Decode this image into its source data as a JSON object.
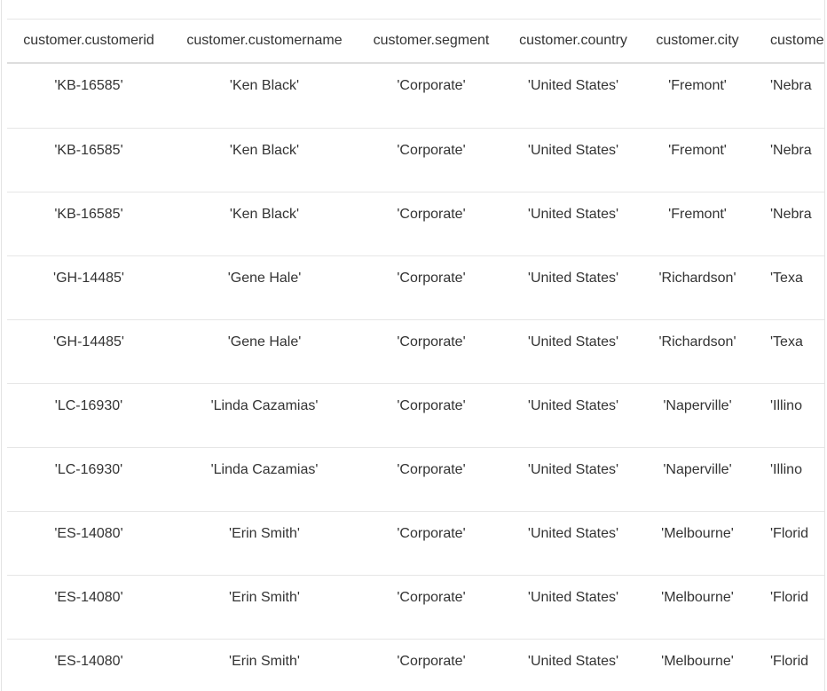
{
  "table": {
    "columns": [
      "customer.customerid",
      "customer.customername",
      "customer.segment",
      "customer.country",
      "customer.city",
      "custome"
    ],
    "rows": [
      [
        "'KB-16585'",
        "'Ken Black'",
        "'Corporate'",
        "'United States'",
        "'Fremont'",
        "'Nebra"
      ],
      [
        "'KB-16585'",
        "'Ken Black'",
        "'Corporate'",
        "'United States'",
        "'Fremont'",
        "'Nebra"
      ],
      [
        "'KB-16585'",
        "'Ken Black'",
        "'Corporate'",
        "'United States'",
        "'Fremont'",
        "'Nebra"
      ],
      [
        "'GH-14485'",
        "'Gene Hale'",
        "'Corporate'",
        "'United States'",
        "'Richardson'",
        "'Texa"
      ],
      [
        "'GH-14485'",
        "'Gene Hale'",
        "'Corporate'",
        "'United States'",
        "'Richardson'",
        "'Texa"
      ],
      [
        "'LC-16930'",
        "'Linda Cazamias'",
        "'Corporate'",
        "'United States'",
        "'Naperville'",
        "'Illino"
      ],
      [
        "'LC-16930'",
        "'Linda Cazamias'",
        "'Corporate'",
        "'United States'",
        "'Naperville'",
        "'Illino"
      ],
      [
        "'ES-14080'",
        "'Erin Smith'",
        "'Corporate'",
        "'United States'",
        "'Melbourne'",
        "'Florid"
      ],
      [
        "'ES-14080'",
        "'Erin Smith'",
        "'Corporate'",
        "'United States'",
        "'Melbourne'",
        "'Florid"
      ],
      [
        "'ES-14080'",
        "'Erin Smith'",
        "'Corporate'",
        "'United States'",
        "'Melbourne'",
        "'Florid"
      ]
    ]
  }
}
